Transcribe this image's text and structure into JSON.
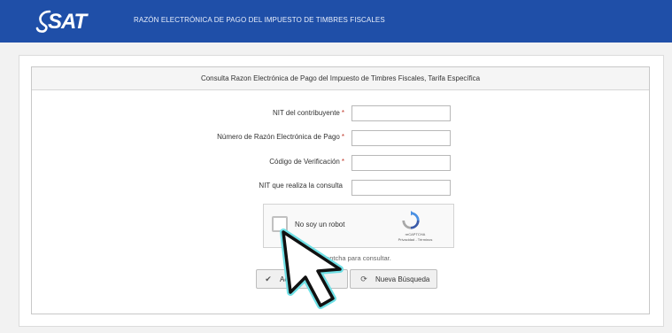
{
  "header": {
    "logo_text": "SAT",
    "title": "RAZÓN ELECTRÓNICA DE PAGO DEL IMPUESTO DE TIMBRES FISCALES"
  },
  "form": {
    "heading": "Consulta Razon Electrónica de Pago del Impuesto de Timbres Fiscales, Tarifa Específica",
    "fields": [
      {
        "label": "NIT del contribuyente",
        "required": "*",
        "value": ""
      },
      {
        "label": "Número de Razón Electrónica de Pago",
        "required": "*",
        "value": ""
      },
      {
        "label": "Código de Verificación",
        "required": "*",
        "value": ""
      },
      {
        "label": "NIT que realiza la consulta",
        "required": "",
        "value": ""
      }
    ]
  },
  "captcha": {
    "label": "No soy un robot",
    "brand": "reCAPTCHA",
    "links": "Privacidad - Términos",
    "checked": false
  },
  "hint": "Resuelva el captcha para consultar.",
  "buttons": {
    "accept_label": "Aceptar",
    "accept_icon": "check-icon",
    "new_search_label": "Nueva Búsqueda",
    "new_search_icon": "refresh-icon"
  },
  "colors": {
    "header_bg": "#1f4fa8",
    "required": "#c0392b",
    "recaptcha_blue": "#4a90e2"
  }
}
